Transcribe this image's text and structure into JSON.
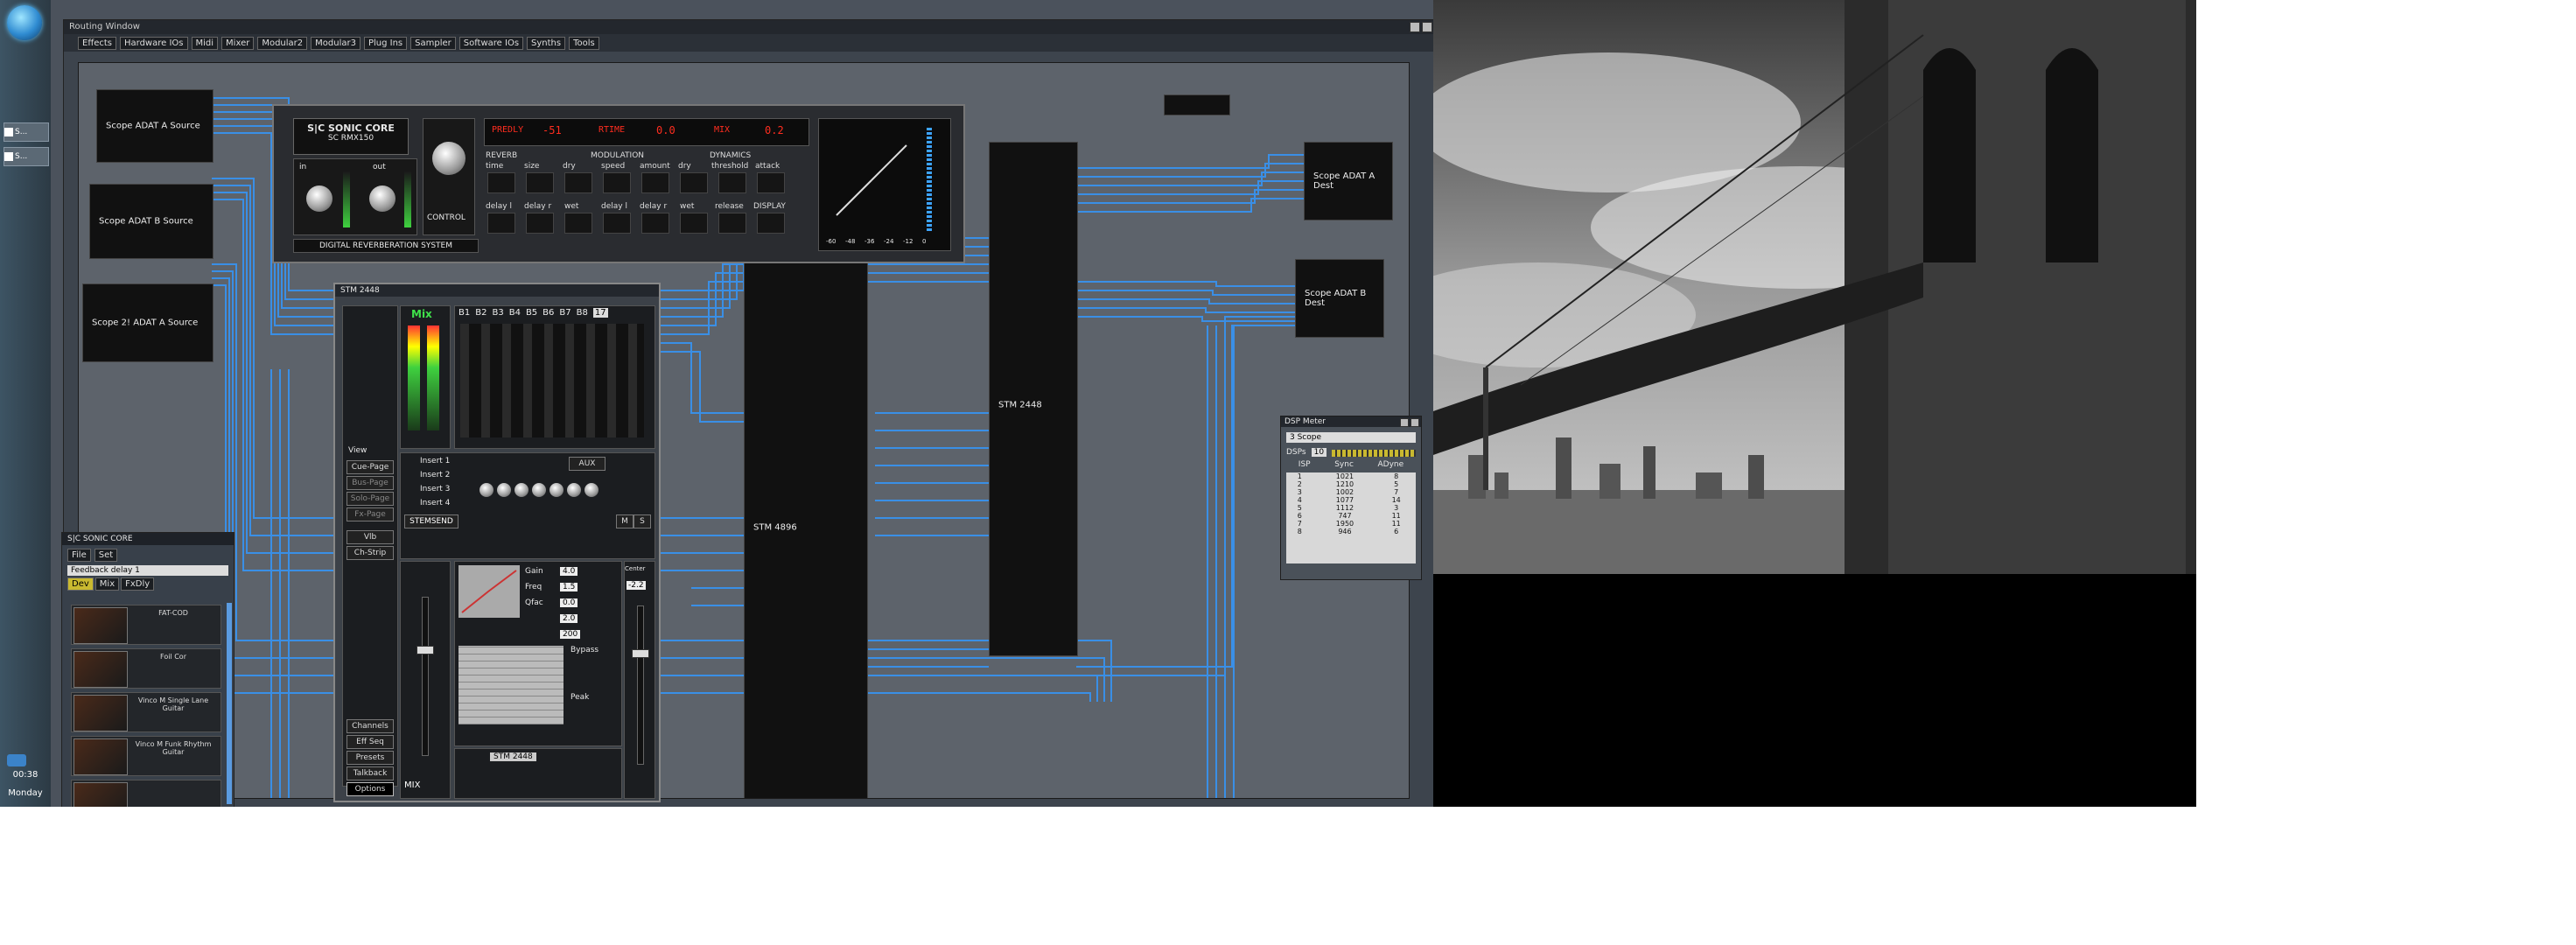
{
  "taskbar": {
    "buttons": [
      "S...",
      "S..."
    ],
    "clock": "00:38",
    "date": "Monday"
  },
  "routing_window": {
    "title": "Routing Window",
    "menu": [
      "Effects",
      "Hardware IOs",
      "Midi",
      "Mixer",
      "Modular2",
      "Modular3",
      "Plug Ins",
      "Sampler",
      "Software IOs",
      "Synths",
      "Tools"
    ]
  },
  "blocks": {
    "adat_a_source": "Scope ADAT A Source",
    "adat_b_source": "Scope ADAT B Source",
    "adat_2_source": "Scope 2! ADAT A Source",
    "adat_a_dest": "Scope ADAT A Dest",
    "adat_b_dest": "Scope ADAT B Dest",
    "stm4896": "STM 4896",
    "stm2448_block": "STM 2448"
  },
  "rmx": {
    "brand": "S|C SONIC CORE",
    "model": "SC RMX150",
    "in_label": "in",
    "out_label": "out",
    "control_label": "CONTROL",
    "lcd_predly_label": "PREDLY",
    "lcd_predly_value": "-51",
    "lcd_rtime_label": "RTIME",
    "lcd_rtime_value": "0.0",
    "lcd_mix_label": "MIX",
    "lcd_mix_value": "0.2",
    "section_reverb": "REVERB",
    "section_modulation": "MODULATION",
    "section_dynamics": "DYNAMICS",
    "row1": [
      "time",
      "size",
      "dry",
      "speed",
      "amount",
      "dry",
      "threshold",
      "attack"
    ],
    "row2": [
      "delay l",
      "delay r",
      "wet",
      "delay l",
      "delay r",
      "wet",
      "release",
      "DISPLAY"
    ],
    "footer": "DIGITAL REVERBERATION SYSTEM",
    "scale": [
      "-60",
      "-48",
      "-36",
      "-24",
      "-12",
      "0"
    ]
  },
  "stm": {
    "title": "STM 2448",
    "mix_label": "Mix",
    "bus_labels": [
      "B1",
      "B2",
      "B3",
      "B4",
      "B5",
      "B6",
      "B7",
      "B8",
      "17"
    ],
    "left_buttons": [
      "Cue-Page",
      "Bus-Page",
      "Solo-Page",
      "Fx-Page",
      "Vlb",
      "Ch-Strip"
    ],
    "view_label": "View",
    "bottom_buttons": [
      "Channels",
      "Eff Seq",
      "Presets",
      "Talkback",
      "Options"
    ],
    "eq_labels": [
      "Gain",
      "Freq",
      "Qfac",
      "Peak",
      "Bypass"
    ],
    "eq_values": [
      "4.0",
      "1.5",
      "0.0",
      "2.0",
      "200"
    ],
    "mix_footer": "MIX",
    "aux_label": "AUX",
    "center_label": "Center",
    "mute_label": "M",
    "solo_label": "S",
    "value_readout": "-2.2",
    "device_label": "STM 2448",
    "insert_labels": [
      "Insert 1",
      "Insert 2",
      "Insert 3",
      "Insert 4"
    ],
    "send_value": "STEMSEND"
  },
  "sc_panel": {
    "title": "S|C SONIC CORE",
    "menu": [
      "File",
      "Set"
    ],
    "tabs": [
      "Dev",
      "Mix",
      "FxDly"
    ],
    "dropdown": "Feedback delay 1",
    "plugins": [
      "FAT-COD",
      "Foil Cor",
      "Vinco M Single Lane Guitar",
      "Vinco M Funk Rhythm Guitar",
      ""
    ]
  },
  "dsp": {
    "title": "DSP Meter",
    "device": "3 Scope",
    "dsp_label": "DSPs",
    "dsp_count": "10",
    "headers": [
      "ISP",
      "Sync",
      "ADyne"
    ],
    "rows": [
      [
        "1",
        "1021",
        "8"
      ],
      [
        "2",
        "1210",
        "5"
      ],
      [
        "3",
        "1002",
        "7"
      ],
      [
        "4",
        "1077",
        "14"
      ],
      [
        "5",
        "1112",
        "3"
      ],
      [
        "6",
        "747",
        "11"
      ],
      [
        "7",
        "1950",
        "11"
      ],
      [
        "8",
        "946",
        "6"
      ]
    ]
  }
}
